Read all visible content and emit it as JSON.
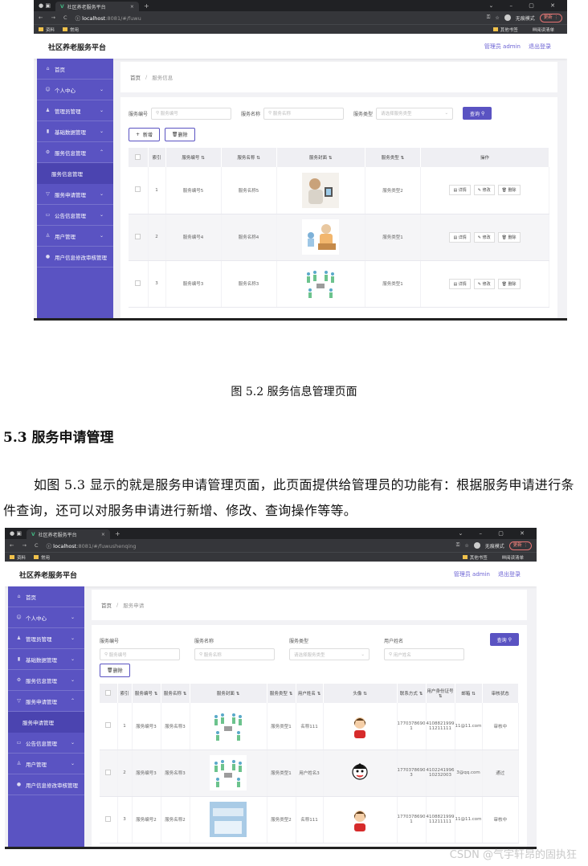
{
  "document": {
    "figure_caption": "图 5.2  服务信息管理页面",
    "section_heading": "5.3 服务申请管理",
    "paragraph": "如图 5.3 显示的就是服务申请管理页面，此页面提供给管理员的功能有：根据服务申请进行条件查询，还可以对服务申请进行新增、修改、查询操作等等。",
    "watermark": "CSDN @气宇轩昂的固执狂"
  },
  "browser": {
    "tab_title": "社区养老服务平台",
    "incognito": "无痕模式",
    "update": "更新",
    "bookmarks": [
      "资料",
      "常用"
    ],
    "bookmarks_right": [
      "其他书签",
      "阅读清单"
    ],
    "url_host": "localhost",
    "url1_path": ":8081/#/fuwu",
    "url2_path": ":8081/#/fuwushenqing"
  },
  "app": {
    "title": "社区养老服务平台",
    "user": "管理员 admin",
    "logout": "退出登录"
  },
  "screen1": {
    "sidebar": [
      {
        "label": "首页",
        "icon": "home-icon",
        "chev": ""
      },
      {
        "label": "个人中心",
        "icon": "user-icon",
        "chev": "⌄"
      },
      {
        "label": "管理员管理",
        "icon": "admin-icon",
        "chev": "⌄"
      },
      {
        "label": "基础数据管理",
        "icon": "chart-icon",
        "chev": "⌄"
      },
      {
        "label": "服务信息管理",
        "icon": "gear-icon",
        "chev": "⌃"
      },
      {
        "label": "服务信息管理",
        "icon": "",
        "chev": "",
        "sub": true
      },
      {
        "label": "服务申请管理",
        "icon": "filter-icon",
        "chev": "⌄"
      },
      {
        "label": "公告信息管理",
        "icon": "board-icon",
        "chev": "⌄"
      },
      {
        "label": "用户管理",
        "icon": "person-icon",
        "chev": "⌄"
      },
      {
        "label": "用户信息修改审核管理",
        "icon": "pin-icon",
        "chev": ""
      }
    ],
    "breadcrumb": {
      "home": "首页",
      "current": "服务信息"
    },
    "filters": {
      "code_label": "服务编号",
      "code_ph": "服务编号",
      "name_label": "服务名称",
      "name_ph": "服务名称",
      "type_label": "服务类型",
      "type_ph": "请选择服务类型",
      "search": "查询"
    },
    "buttons": {
      "add": "新增",
      "delete": "删除"
    },
    "columns": [
      "索引",
      "服务编号",
      "服务名称",
      "服务封面",
      "服务类型",
      "操作"
    ],
    "rows": [
      {
        "idx": "1",
        "code": "服务编号5",
        "name": "服务名称5",
        "type": "服务类型2"
      },
      {
        "idx": "2",
        "code": "服务编号4",
        "name": "服务名称4",
        "type": "服务类型1"
      },
      {
        "idx": "3",
        "code": "服务编号3",
        "name": "服务名称3",
        "type": "服务类型1"
      }
    ],
    "ops": {
      "detail": "详情",
      "edit": "修改",
      "del": "删除"
    }
  },
  "screen2": {
    "sidebar": [
      {
        "label": "首页",
        "icon": "home-icon",
        "chev": ""
      },
      {
        "label": "个人中心",
        "icon": "user-icon",
        "chev": "⌄"
      },
      {
        "label": "管理员管理",
        "icon": "admin-icon",
        "chev": "⌄"
      },
      {
        "label": "基础数据管理",
        "icon": "chart-icon",
        "chev": "⌄"
      },
      {
        "label": "服务信息管理",
        "icon": "gear-icon",
        "chev": "⌄"
      },
      {
        "label": "服务申请管理",
        "icon": "filter-icon",
        "chev": "⌃"
      },
      {
        "label": "服务申请管理",
        "icon": "",
        "chev": "",
        "sub": true
      },
      {
        "label": "公告信息管理",
        "icon": "board-icon",
        "chev": "⌄"
      },
      {
        "label": "用户管理",
        "icon": "person-icon",
        "chev": "⌄"
      },
      {
        "label": "用户信息修改审核管理",
        "icon": "pin-icon",
        "chev": ""
      }
    ],
    "breadcrumb": {
      "home": "首页",
      "current": "服务申请"
    },
    "filters": {
      "code_label": "服务编号",
      "code_ph": "服务编号",
      "name_label": "服务名称",
      "name_ph": "服务名称",
      "type_label": "服务类型",
      "type_ph": "请选择服务类型",
      "user_label": "用户姓名",
      "user_ph": "用户姓名",
      "search": "查询"
    },
    "buttons": {
      "delete": "删除"
    },
    "columns": [
      "索引",
      "服务编号",
      "服务名称",
      "服务封面",
      "服务类型",
      "用户姓名",
      "头像",
      "联系方式",
      "用户身份证号",
      "邮箱",
      "审核状态"
    ],
    "rows": [
      {
        "idx": "1",
        "code": "服务编号3",
        "name": "服务名称3",
        "type": "服务类型1",
        "user": "名称111",
        "phone": "17703786901",
        "idcard": "410882199911211111",
        "email": "11@11.com",
        "status": "审核中"
      },
      {
        "idx": "2",
        "code": "服务编号3",
        "name": "服务名称3",
        "type": "服务类型1",
        "user": "用户姓名3",
        "phone": "17703786903",
        "idcard": "410224199610232003",
        "email": "3@qq.com",
        "status": "通过"
      },
      {
        "idx": "3",
        "code": "服务编号2",
        "name": "服务名称2",
        "type": "服务类型2",
        "user": "名称111",
        "phone": "17703786901",
        "idcard": "410882199911211111",
        "email": "11@11.com",
        "status": "审核中"
      }
    ]
  }
}
